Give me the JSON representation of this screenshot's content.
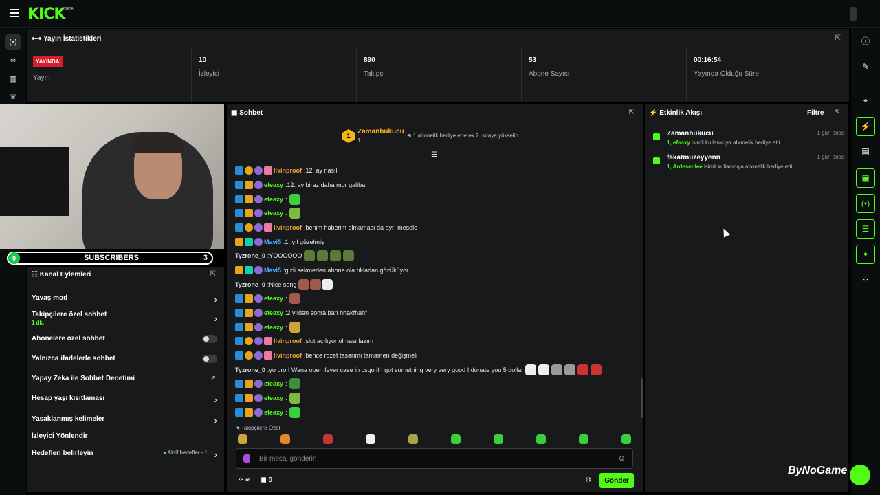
{
  "brand": {
    "logo": "KICK",
    "beta": "BETA",
    "accent": "#53fc18"
  },
  "stats": {
    "title": "Yayın İstatistikleri",
    "live_badge": "YAYINDA",
    "live_label": "Yayın",
    "items": [
      {
        "value": "10",
        "label": "İzleyici"
      },
      {
        "value": "890",
        "label": "Takipçi"
      },
      {
        "value": "53",
        "label": "Abone Sayısı"
      },
      {
        "value": "00:16:54",
        "label": "Yayında Olduğu Süre"
      }
    ]
  },
  "subscribers_bar": {
    "left": "0",
    "label": "SUBSCRIBERS",
    "right": "3"
  },
  "channel_actions": {
    "title": "Kanal Eylemleri",
    "items": [
      {
        "label": "Yavaş mod"
      },
      {
        "label": "Takipçilere özel sohbet",
        "sub": "1 dk."
      },
      {
        "label": "Abonelere özel sohbet"
      },
      {
        "label": "Yalnızca ifadelerle sohbet"
      },
      {
        "label": "Yapay Zeka ile Sohbet Denetimi"
      },
      {
        "label": "Hesap yaşı kısıtlaması"
      },
      {
        "label": "Yasaklanmış kelimeler"
      },
      {
        "label": "İzleyici Yönlendir"
      },
      {
        "label": "Hedefleri belirleyin",
        "goal": "Aktif hedefler - 1"
      }
    ]
  },
  "chat": {
    "title": "Sohbet",
    "pinned": {
      "level": "1",
      "user": "Zamanbukucu",
      "count": "1",
      "text": "1 abonelik hediye ederek 2. sıraya yükselin"
    },
    "messages": [
      {
        "user": "livinproof",
        "text": "12. ay nasıl"
      },
      {
        "user": "efeaxy",
        "text": "12. ay biraz daha mor galiba"
      },
      {
        "user": "efeaxy",
        "text": ""
      },
      {
        "user": "efeaxy",
        "text": ""
      },
      {
        "user": "livinproof",
        "text": "benim haberim olmaması da ayrı mesele"
      },
      {
        "user": "Mavi5",
        "text": "1. yıl güzelmiş"
      },
      {
        "user": "Tyzrone_0",
        "text": "YOOOOOO"
      },
      {
        "user": "Mavi5",
        "text": "gizli sekmeden abone ola tıkladan gözüküyor"
      },
      {
        "user": "Tyzrone_0",
        "text": "Nice song"
      },
      {
        "user": "efeaxy",
        "text": ""
      },
      {
        "user": "efeaxy",
        "text": "2 yıldan sonra ban hhakfhahf"
      },
      {
        "user": "efeaxy",
        "text": ""
      },
      {
        "user": "livinproof",
        "text": "slot açılıyor olması lazım"
      },
      {
        "user": "livinproof",
        "text": "bence rozet tasarımı tamamen değişmeli"
      },
      {
        "user": "Tyzrone_0",
        "text": "yo bro I Wana open fever case in csgo if I got something very very good I donate you 5 dollar"
      },
      {
        "user": "efeaxy",
        "text": ""
      },
      {
        "user": "efeaxy",
        "text": ""
      },
      {
        "user": "efeaxy",
        "text": ""
      }
    ],
    "followers_only_label": "Takipçilere Özel",
    "input_placeholder": "Bir mesaj gönderin",
    "points": "∞",
    "gift_count": "0",
    "send_label": "Gönder"
  },
  "activity": {
    "title": "Etkinlik Akışı",
    "filter": "Filtre",
    "items": [
      {
        "user": "Zamanbukucu",
        "time": "1 gün önce",
        "detail_prefix": "1, efeaxy",
        "detail": "isimli kullanıcıya abonelik hediye etti."
      },
      {
        "user": "fakatmuzeyyenn",
        "time": "1 gün önce",
        "detail_prefix": "1, Ardesenlee",
        "detail": "isimli kullanıcıya abonelik hediye etti."
      }
    ]
  },
  "watermark": "ByNoGame"
}
